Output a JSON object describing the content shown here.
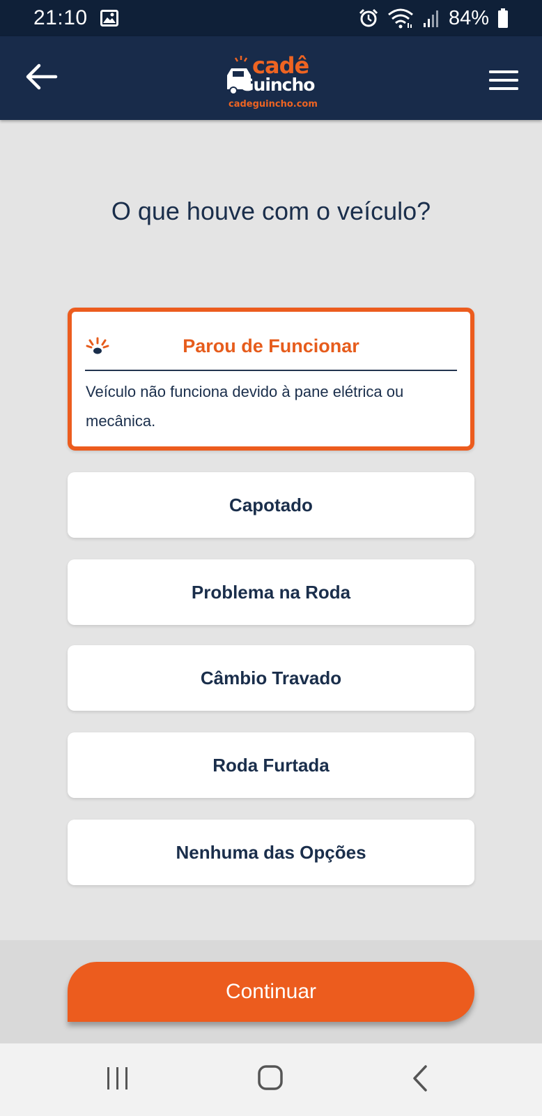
{
  "status_bar": {
    "time": "21:10",
    "battery": "84%",
    "icons": [
      "image-icon",
      "alarm-icon",
      "wifi-icon",
      "signal-icon",
      "battery-icon"
    ]
  },
  "header": {
    "logo_top": "cadê",
    "logo_mid": "Guincho",
    "logo_url": "cadeguincho.com",
    "back_icon": "arrow-left-icon",
    "menu_icon": "hamburger-menu-icon"
  },
  "question": "O que houve com o veículo?",
  "selected_option": {
    "title": "Parou de Funcionar",
    "description": "Veículo não funciona devido à pane elétrica ou mecânica.",
    "icon": "warning-light-icon"
  },
  "options": [
    {
      "label": "Capotado"
    },
    {
      "label": "Problema na Roda"
    },
    {
      "label": "Câmbio Travado"
    },
    {
      "label": "Roda Furtada"
    },
    {
      "label": "Nenhuma das Opções"
    }
  ],
  "continue_label": "Continuar",
  "colors": {
    "accent": "#ec5c1e",
    "header": "#182b4a",
    "status_bar": "#0f2038",
    "text": "#1a2e4b",
    "background": "#e4e4e4"
  }
}
